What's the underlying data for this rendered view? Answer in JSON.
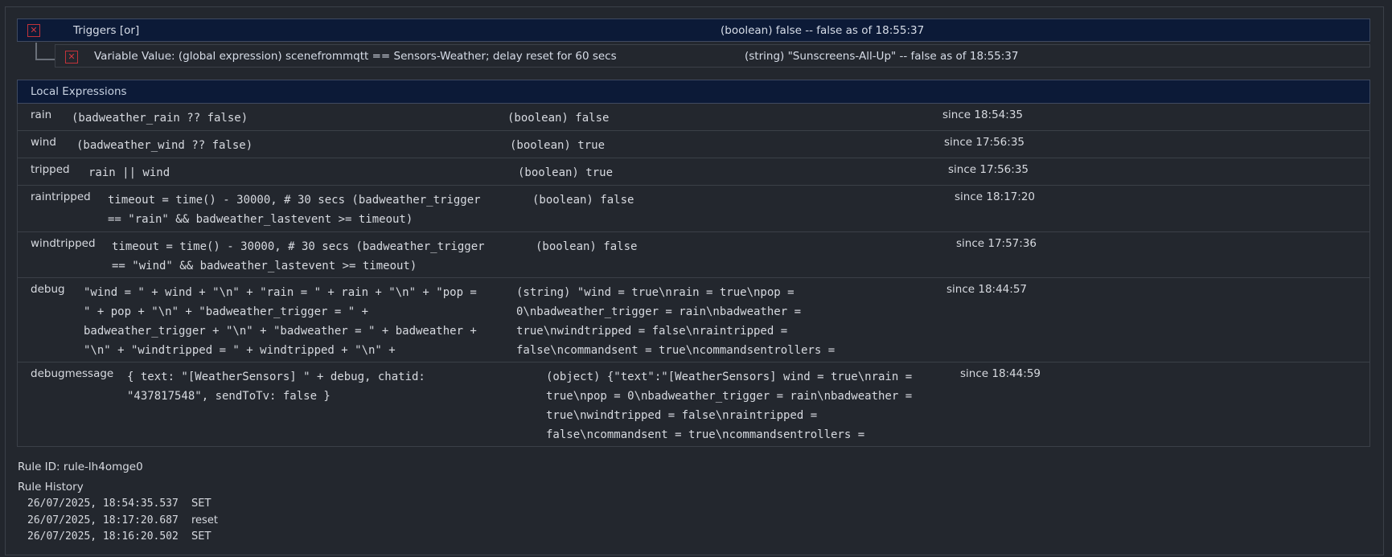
{
  "triggers": {
    "title": "Triggers [or]",
    "value": "(boolean) false -- false as of 18:55:37",
    "sub": {
      "label": "Variable Value: (global expression) scenefrommqtt == Sensors-Weather; delay reset for 60 secs",
      "value": "(string) \"Sunscreens-All-Up\" -- false as of 18:55:37"
    }
  },
  "locals": {
    "title": "Local Expressions",
    "rows": [
      {
        "name": "rain",
        "expr": "(badweather_rain ?? false)",
        "value": "(boolean) false",
        "since": "since 18:54:35"
      },
      {
        "name": "wind",
        "expr": "(badweather_wind ?? false)",
        "value": "(boolean) true",
        "since": "since 17:56:35"
      },
      {
        "name": "tripped",
        "expr": "rain || wind",
        "value": "(boolean) true",
        "since": "since 17:56:35"
      },
      {
        "name": "raintripped",
        "expr": "timeout = time() - 30000, # 30 secs (badweather_trigger\n== \"rain\" && badweather_lastevent >= timeout)",
        "value": "(boolean) false",
        "since": "since 18:17:20"
      },
      {
        "name": "windtripped",
        "expr": "timeout = time() - 30000, # 30 secs (badweather_trigger\n== \"wind\" && badweather_lastevent >= timeout)",
        "value": "(boolean) false",
        "since": "since 17:57:36"
      },
      {
        "name": "debug",
        "expr": "\"wind = \" + wind + \"\\n\" + \"rain = \" + rain + \"\\n\" + \"pop =\n\" + pop + \"\\n\" + \"badweather_trigger = \" +\nbadweather_trigger + \"\\n\" + \"badweather = \" + badweather +\n\"\\n\" + \"windtripped = \" + windtripped + \"\\n\" +",
        "value": "(string) \"wind = true\\nrain = true\\npop =\n0\\nbadweather_trigger = rain\\nbadweather =\ntrue\\nwindtripped = false\\nraintripped =\nfalse\\ncommandsent = true\\ncommandsentrollers =",
        "since": "since 18:44:57"
      },
      {
        "name": "debugmessage",
        "expr": "{ text: \"[WeatherSensors] \" + debug, chatid:\n\"437817548\", sendToTv: false }",
        "value": "(object) {\"text\":\"[WeatherSensors] wind = true\\nrain =\ntrue\\npop = 0\\nbadweather_trigger = rain\\nbadweather =\ntrue\\nwindtripped = false\\nraintripped =\nfalse\\ncommandsent = true\\ncommandsentrollers =",
        "since": "since 18:44:59"
      }
    ]
  },
  "rule_id": "Rule ID: rule-lh4omge0",
  "history": {
    "title": "Rule History",
    "entries": [
      {
        "time": "26/07/2025, 18:54:35.537",
        "event": "SET"
      },
      {
        "time": "26/07/2025, 18:17:20.687",
        "event": "reset"
      },
      {
        "time": "26/07/2025, 18:16:20.502",
        "event": "SET"
      }
    ]
  }
}
